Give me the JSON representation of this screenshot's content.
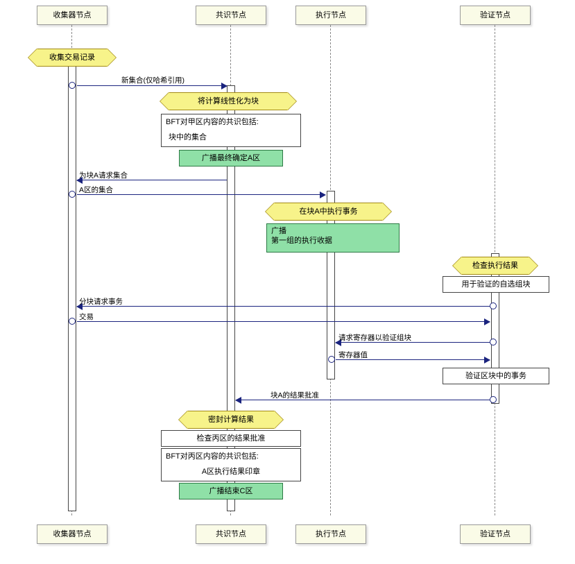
{
  "participants": {
    "collector": "收集器节点",
    "consensus": "共识节点",
    "execution": "执行节点",
    "verify": "验证节点"
  },
  "activities": {
    "collectTx": "收集交易记录",
    "linearize": "将计算线性化为块",
    "execInA": "在块A中执行事务",
    "checkExec": "检查执行结果",
    "sealResult": "密封计算结果"
  },
  "notes": {
    "bftA_l1": "BFT对甲区内容的共识包括:",
    "bftA_l2": "块中的集合",
    "bcastA": "广播最终确定A区",
    "bcast_l1": "广播",
    "bcast_l2": "第一组的执行收据",
    "selfSel": "用于验证的自选组块",
    "verifyTx": "验证区块中的事务",
    "checkC": "检查丙区的结果批准",
    "bftC_l1": "BFT对丙区内容的共识包括:",
    "bftC_l2": "A区执行结果印章",
    "bcastC": "广播结束C区"
  },
  "messages": {
    "newSet": "新集合(仅哈希引用)",
    "reqSetA": "为块A请求集合",
    "setA": "A区的集合",
    "reqTxChunk": "分块请求事务",
    "tx": "交易",
    "reqReg": "请求寄存器以验证组块",
    "regVal": "寄存器值",
    "approveA": "块A的结果批准"
  }
}
